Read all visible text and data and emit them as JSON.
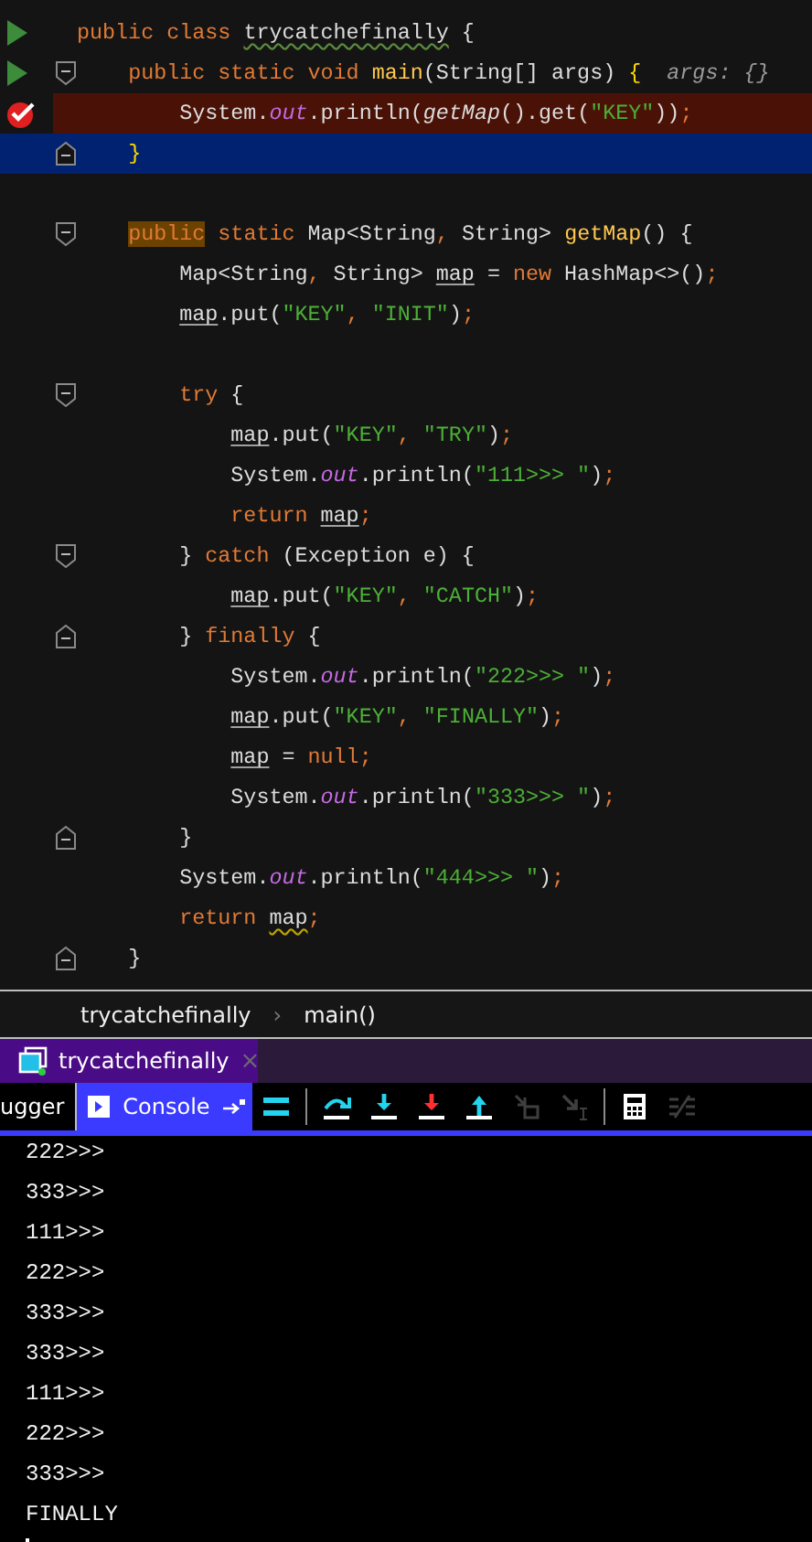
{
  "editor": {
    "lines": [
      {
        "kind": "code",
        "gutter": {
          "kind": "run"
        },
        "tokens": [
          {
            "kind": "kw",
            "text": "public class "
          },
          {
            "kind": "clswarn",
            "text": "trycatchefinally"
          },
          {
            "kind": "txt",
            "text": " {"
          }
        ]
      },
      {
        "kind": "code",
        "gutter": {
          "kind": "run"
        },
        "fold": {
          "kind": "start"
        },
        "tokens": [
          {
            "kind": "kw",
            "text": "    public static void "
          },
          {
            "kind": "decl",
            "text": "main"
          },
          {
            "kind": "txt",
            "text": "(String[] args) "
          },
          {
            "kind": "brace",
            "text": "{"
          },
          {
            "kind": "hint",
            "text": "  args: {}"
          }
        ]
      },
      {
        "kind": "code",
        "gutter": {
          "kind": "breakpoint"
        },
        "highlight": {
          "kind": "breakpoint"
        },
        "tokens": [
          {
            "kind": "txt",
            "text": "        System."
          },
          {
            "kind": "fld",
            "text": "out"
          },
          {
            "kind": "txt",
            "text": ".println("
          },
          {
            "kind": "ital",
            "text": "getMap"
          },
          {
            "kind": "txt",
            "text": "().get("
          },
          {
            "kind": "str",
            "text": "\"KEY\""
          },
          {
            "kind": "txt",
            "text": "))"
          },
          {
            "kind": "pun",
            "text": ";"
          }
        ]
      },
      {
        "kind": "code",
        "fold": {
          "kind": "end"
        },
        "highlight": {
          "kind": "execution"
        },
        "tokens": [
          {
            "kind": "brace",
            "text": "    }"
          }
        ]
      },
      {
        "kind": "blank"
      },
      {
        "kind": "code",
        "fold": {
          "kind": "start"
        },
        "tokens": [
          {
            "kind": "kwmark",
            "text": "    public"
          },
          {
            "kind": "kw",
            "text": " static "
          },
          {
            "kind": "txt",
            "text": "Map<String"
          },
          {
            "kind": "pun",
            "text": ","
          },
          {
            "kind": "txt",
            "text": " String> "
          },
          {
            "kind": "decl",
            "text": "getMap"
          },
          {
            "kind": "txt",
            "text": "() {"
          }
        ]
      },
      {
        "kind": "code",
        "tokens": [
          {
            "kind": "txt",
            "text": "        Map<String"
          },
          {
            "kind": "pun",
            "text": ","
          },
          {
            "kind": "txt",
            "text": " String> "
          },
          {
            "kind": "var",
            "text": "map"
          },
          {
            "kind": "txt",
            "text": " = "
          },
          {
            "kind": "kw",
            "text": "new"
          },
          {
            "kind": "txt",
            "text": " HashMap<>()"
          },
          {
            "kind": "pun",
            "text": ";"
          }
        ]
      },
      {
        "kind": "code",
        "tokens": [
          {
            "kind": "var",
            "text": "        map"
          },
          {
            "kind": "txt",
            "text": ".put("
          },
          {
            "kind": "str",
            "text": "\"KEY\""
          },
          {
            "kind": "pun",
            "text": ", "
          },
          {
            "kind": "str",
            "text": "\"INIT\""
          },
          {
            "kind": "txt",
            "text": ")"
          },
          {
            "kind": "pun",
            "text": ";"
          }
        ]
      },
      {
        "kind": "blank"
      },
      {
        "kind": "code",
        "fold": {
          "kind": "start"
        },
        "tokens": [
          {
            "kind": "kw",
            "text": "        try"
          },
          {
            "kind": "txt",
            "text": " {"
          }
        ]
      },
      {
        "kind": "code",
        "tokens": [
          {
            "kind": "var",
            "text": "            map"
          },
          {
            "kind": "txt",
            "text": ".put("
          },
          {
            "kind": "str",
            "text": "\"KEY\""
          },
          {
            "kind": "pun",
            "text": ", "
          },
          {
            "kind": "str",
            "text": "\"TRY\""
          },
          {
            "kind": "txt",
            "text": ")"
          },
          {
            "kind": "pun",
            "text": ";"
          }
        ]
      },
      {
        "kind": "code",
        "tokens": [
          {
            "kind": "txt",
            "text": "            System."
          },
          {
            "kind": "fld",
            "text": "out"
          },
          {
            "kind": "txt",
            "text": ".println("
          },
          {
            "kind": "str",
            "text": "\"111>>> \""
          },
          {
            "kind": "txt",
            "text": ")"
          },
          {
            "kind": "pun",
            "text": ";"
          }
        ]
      },
      {
        "kind": "code",
        "tokens": [
          {
            "kind": "kw",
            "text": "            return "
          },
          {
            "kind": "var",
            "text": "map"
          },
          {
            "kind": "pun",
            "text": ";"
          }
        ]
      },
      {
        "kind": "code",
        "fold": {
          "kind": "start"
        },
        "tokens": [
          {
            "kind": "txt",
            "text": "        } "
          },
          {
            "kind": "kw",
            "text": "catch"
          },
          {
            "kind": "txt",
            "text": " (Exception e) {"
          }
        ]
      },
      {
        "kind": "code",
        "tokens": [
          {
            "kind": "var",
            "text": "            map"
          },
          {
            "kind": "txt",
            "text": ".put("
          },
          {
            "kind": "str",
            "text": "\"KEY\""
          },
          {
            "kind": "pun",
            "text": ", "
          },
          {
            "kind": "str",
            "text": "\"CATCH\""
          },
          {
            "kind": "txt",
            "text": ")"
          },
          {
            "kind": "pun",
            "text": ";"
          }
        ]
      },
      {
        "kind": "code",
        "fold": {
          "kind": "end"
        },
        "tokens": [
          {
            "kind": "txt",
            "text": "        } "
          },
          {
            "kind": "kw",
            "text": "finally"
          },
          {
            "kind": "txt",
            "text": " {"
          }
        ]
      },
      {
        "kind": "code",
        "tokens": [
          {
            "kind": "txt",
            "text": "            System."
          },
          {
            "kind": "fld",
            "text": "out"
          },
          {
            "kind": "txt",
            "text": ".println("
          },
          {
            "kind": "str",
            "text": "\"222>>> \""
          },
          {
            "kind": "txt",
            "text": ")"
          },
          {
            "kind": "pun",
            "text": ";"
          }
        ]
      },
      {
        "kind": "code",
        "tokens": [
          {
            "kind": "var",
            "text": "            map"
          },
          {
            "kind": "txt",
            "text": ".put("
          },
          {
            "kind": "str",
            "text": "\"KEY\""
          },
          {
            "kind": "pun",
            "text": ", "
          },
          {
            "kind": "str",
            "text": "\"FINALLY\""
          },
          {
            "kind": "txt",
            "text": ")"
          },
          {
            "kind": "pun",
            "text": ";"
          }
        ]
      },
      {
        "kind": "code",
        "tokens": [
          {
            "kind": "var",
            "text": "            map"
          },
          {
            "kind": "txt",
            "text": " = "
          },
          {
            "kind": "kw",
            "text": "null"
          },
          {
            "kind": "pun",
            "text": ";"
          }
        ]
      },
      {
        "kind": "code",
        "tokens": [
          {
            "kind": "txt",
            "text": "            System."
          },
          {
            "kind": "fld",
            "text": "out"
          },
          {
            "kind": "txt",
            "text": ".println("
          },
          {
            "kind": "str",
            "text": "\"333>>> \""
          },
          {
            "kind": "txt",
            "text": ")"
          },
          {
            "kind": "pun",
            "text": ";"
          }
        ]
      },
      {
        "kind": "code",
        "fold": {
          "kind": "end"
        },
        "tokens": [
          {
            "kind": "txt",
            "text": "        }"
          }
        ]
      },
      {
        "kind": "code",
        "tokens": [
          {
            "kind": "txt",
            "text": "        System."
          },
          {
            "kind": "fld",
            "text": "out"
          },
          {
            "kind": "txt",
            "text": ".println("
          },
          {
            "kind": "str",
            "text": "\"444>>> \""
          },
          {
            "kind": "txt",
            "text": ")"
          },
          {
            "kind": "pun",
            "text": ";"
          }
        ]
      },
      {
        "kind": "code",
        "tokens": [
          {
            "kind": "kw",
            "text": "        return "
          },
          {
            "kind": "varwarn",
            "text": "map"
          },
          {
            "kind": "pun",
            "text": ";"
          }
        ]
      },
      {
        "kind": "code",
        "fold": {
          "kind": "end"
        },
        "tokens": [
          {
            "kind": "txt",
            "text": "    }"
          }
        ]
      }
    ]
  },
  "breadcrumb": [
    "trycatchefinally",
    "main()"
  ],
  "breadcrumb_separator": "›",
  "session_tab": {
    "label": "trycatchefinally",
    "close": "×"
  },
  "debug_tabs": [
    {
      "label": "ugger",
      "selected": false
    },
    {
      "label": "Console",
      "selected": true
    }
  ],
  "toolbar": [
    {
      "kind": "lines",
      "disabled": false
    },
    {
      "kind": "sep"
    },
    {
      "kind": "step-over",
      "disabled": false
    },
    {
      "kind": "step-into",
      "disabled": false
    },
    {
      "kind": "force-step-into",
      "disabled": false
    },
    {
      "kind": "step-out",
      "disabled": false
    },
    {
      "kind": "drop-frame",
      "disabled": true
    },
    {
      "kind": "run-to-cursor",
      "disabled": true
    },
    {
      "kind": "sep"
    },
    {
      "kind": "calculator",
      "disabled": false
    },
    {
      "kind": "trace",
      "disabled": true
    }
  ],
  "console": {
    "lines": [
      "222>>>",
      "333>>>",
      "111>>>",
      "222>>>",
      "333>>>",
      "333>>>",
      "111>>>",
      "222>>>",
      "333>>>",
      "FINALLY"
    ],
    "cursor": true
  }
}
